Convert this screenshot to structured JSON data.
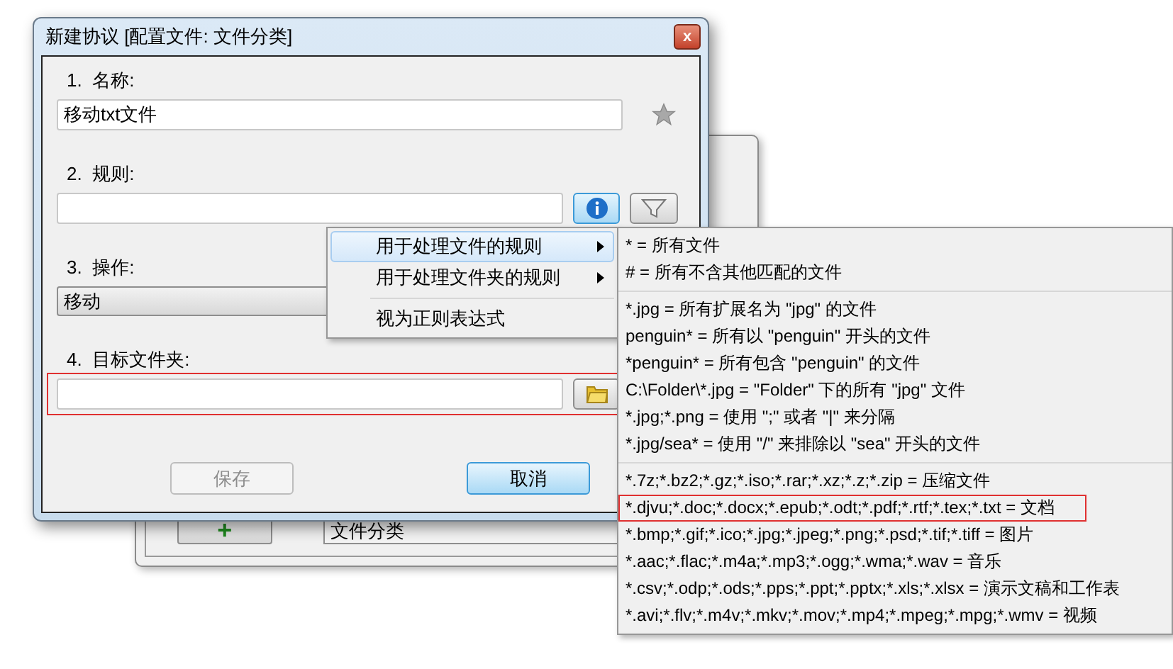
{
  "background_window": {
    "add_button": {
      "label": "+"
    },
    "profile_select": {
      "value": "文件分类"
    }
  },
  "dialog": {
    "title": "新建协议 [配置文件: 文件分类]",
    "close": "x",
    "fields": [
      {
        "kind": "text",
        "label": "1.  名称:",
        "value": "移动txt文件",
        "highlighted": false
      },
      {
        "kind": "rule",
        "label": "2.  规则:",
        "highlighted": false
      },
      {
        "kind": "select",
        "label": "3.  操作:",
        "value": "移动",
        "highlighted": false
      },
      {
        "kind": "folder",
        "label": "4.  目标文件夹:",
        "highlighted": true
      }
    ],
    "buttons": [
      {
        "label": "保存",
        "disabled": true,
        "default": false
      },
      {
        "label": "取消",
        "disabled": false,
        "default": true
      }
    ]
  },
  "context_menu": [
    {
      "kind": "item",
      "label": "用于处理文件的规则",
      "selected": true,
      "submenu": true
    },
    {
      "kind": "item",
      "label": "用于处理文件夹的规则",
      "selected": false,
      "submenu": true
    },
    {
      "kind": "separator"
    },
    {
      "kind": "item",
      "label": "视为正则表达式",
      "selected": false,
      "submenu": false
    }
  ],
  "submenu": [
    [
      {
        "text": "* = 所有文件",
        "highlighted": false
      },
      {
        "text": "# = 所有不含其他匹配的文件",
        "highlighted": false
      }
    ],
    [
      {
        "text": "*.jpg = 所有扩展名为 \"jpg\" 的文件",
        "highlighted": false
      },
      {
        "text": "penguin* = 所有以 \"penguin\" 开头的文件",
        "highlighted": false
      },
      {
        "text": "*penguin* = 所有包含 \"penguin\" 的文件",
        "highlighted": false
      },
      {
        "text": "C:\\Folder\\*.jpg = \"Folder\" 下的所有 \"jpg\" 文件",
        "highlighted": false
      },
      {
        "text": "*.jpg;*.png = 使用 \";\" 或者 \"|\" 来分隔",
        "highlighted": false
      },
      {
        "text": "*.jpg/sea* = 使用 \"/\" 来排除以 \"sea\" 开头的文件",
        "highlighted": false
      }
    ],
    [
      {
        "text": "*.7z;*.bz2;*.gz;*.iso;*.rar;*.xz;*.z;*.zip = 压缩文件",
        "highlighted": false
      },
      {
        "text": "*.djvu;*.doc;*.docx;*.epub;*.odt;*.pdf;*.rtf;*.tex;*.txt = 文档",
        "highlighted": true
      },
      {
        "text": "*.bmp;*.gif;*.ico;*.jpg;*.jpeg;*.png;*.psd;*.tif;*.tiff = 图片",
        "highlighted": false
      },
      {
        "text": "*.aac;*.flac;*.m4a;*.mp3;*.ogg;*.wma;*.wav = 音乐",
        "highlighted": false
      },
      {
        "text": "*.csv;*.odp;*.ods;*.pps;*.ppt;*.pptx;*.xls;*.xlsx = 演示文稿和工作表",
        "highlighted": false
      },
      {
        "text": "*.avi;*.flv;*.m4v;*.mkv;*.mov;*.mp4;*.mpeg;*.mpg;*.wmv = 视频",
        "highlighted": false
      }
    ]
  ]
}
